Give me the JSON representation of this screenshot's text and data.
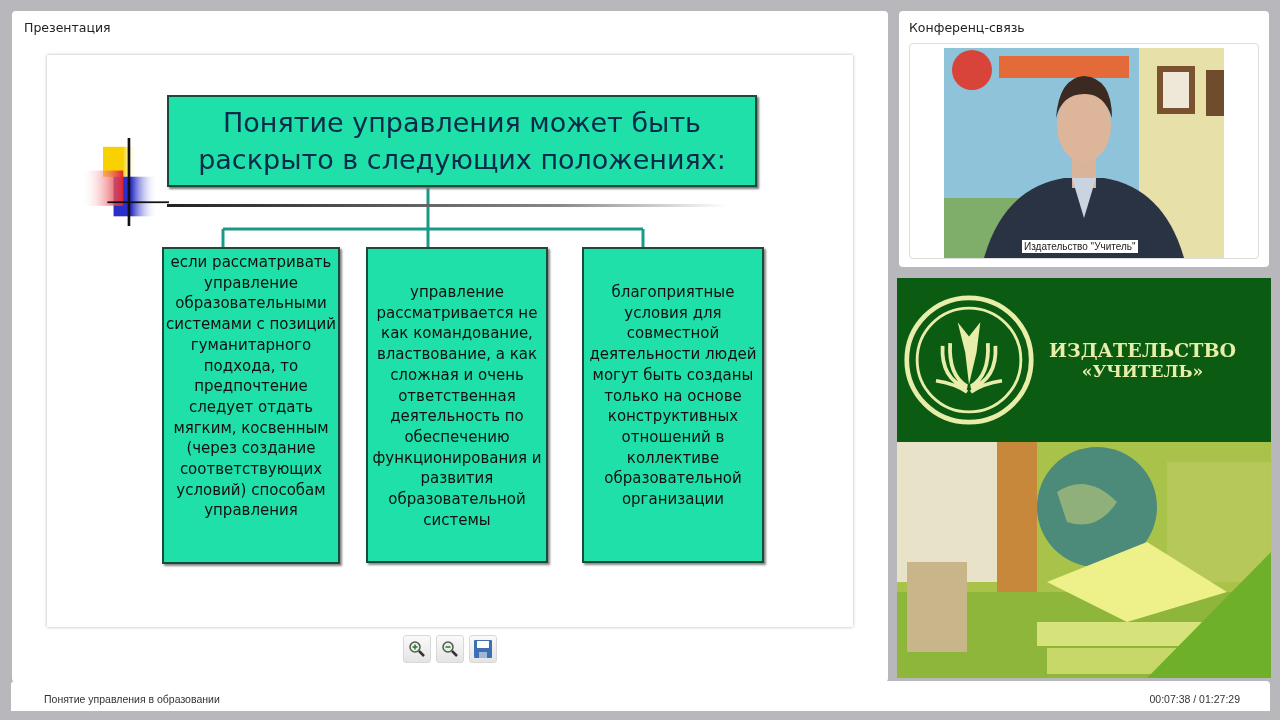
{
  "presentation": {
    "title": "Презентация",
    "slide": {
      "heading": "Понятие управления может быть раскрыто в следующих положениях:",
      "items": [
        "если рассматривать управление образовательными системами с позиций гуманитарного подхода, то предпочтение следует отдать мягким, косвенным (через создание соответствующих условий) способам управления",
        "управление рассматривается не как командование, властвование, а как сложная и очень ответственная деятельность по обеспечению функционирования и развития образовательной системы",
        "благоприятные условия для совместной деятельности людей могут быть созданы только на основе конструктивных отношений в коллективе образовательной организации"
      ]
    },
    "toolbar": [
      {
        "kind": "zoom-in"
      },
      {
        "kind": "zoom-out"
      },
      {
        "kind": "save"
      }
    ]
  },
  "conference": {
    "title": "Конференц-связь",
    "caption": "Издательство \"Учитель\""
  },
  "publisher": {
    "name": "ИЗДАТЕЛЬСТВО",
    "quoted": "«УЧИТЕЛЬ»"
  },
  "status_bar": {
    "lecture": "Понятие управления в образовании",
    "time": "00:07:38 / 01:27:29"
  }
}
